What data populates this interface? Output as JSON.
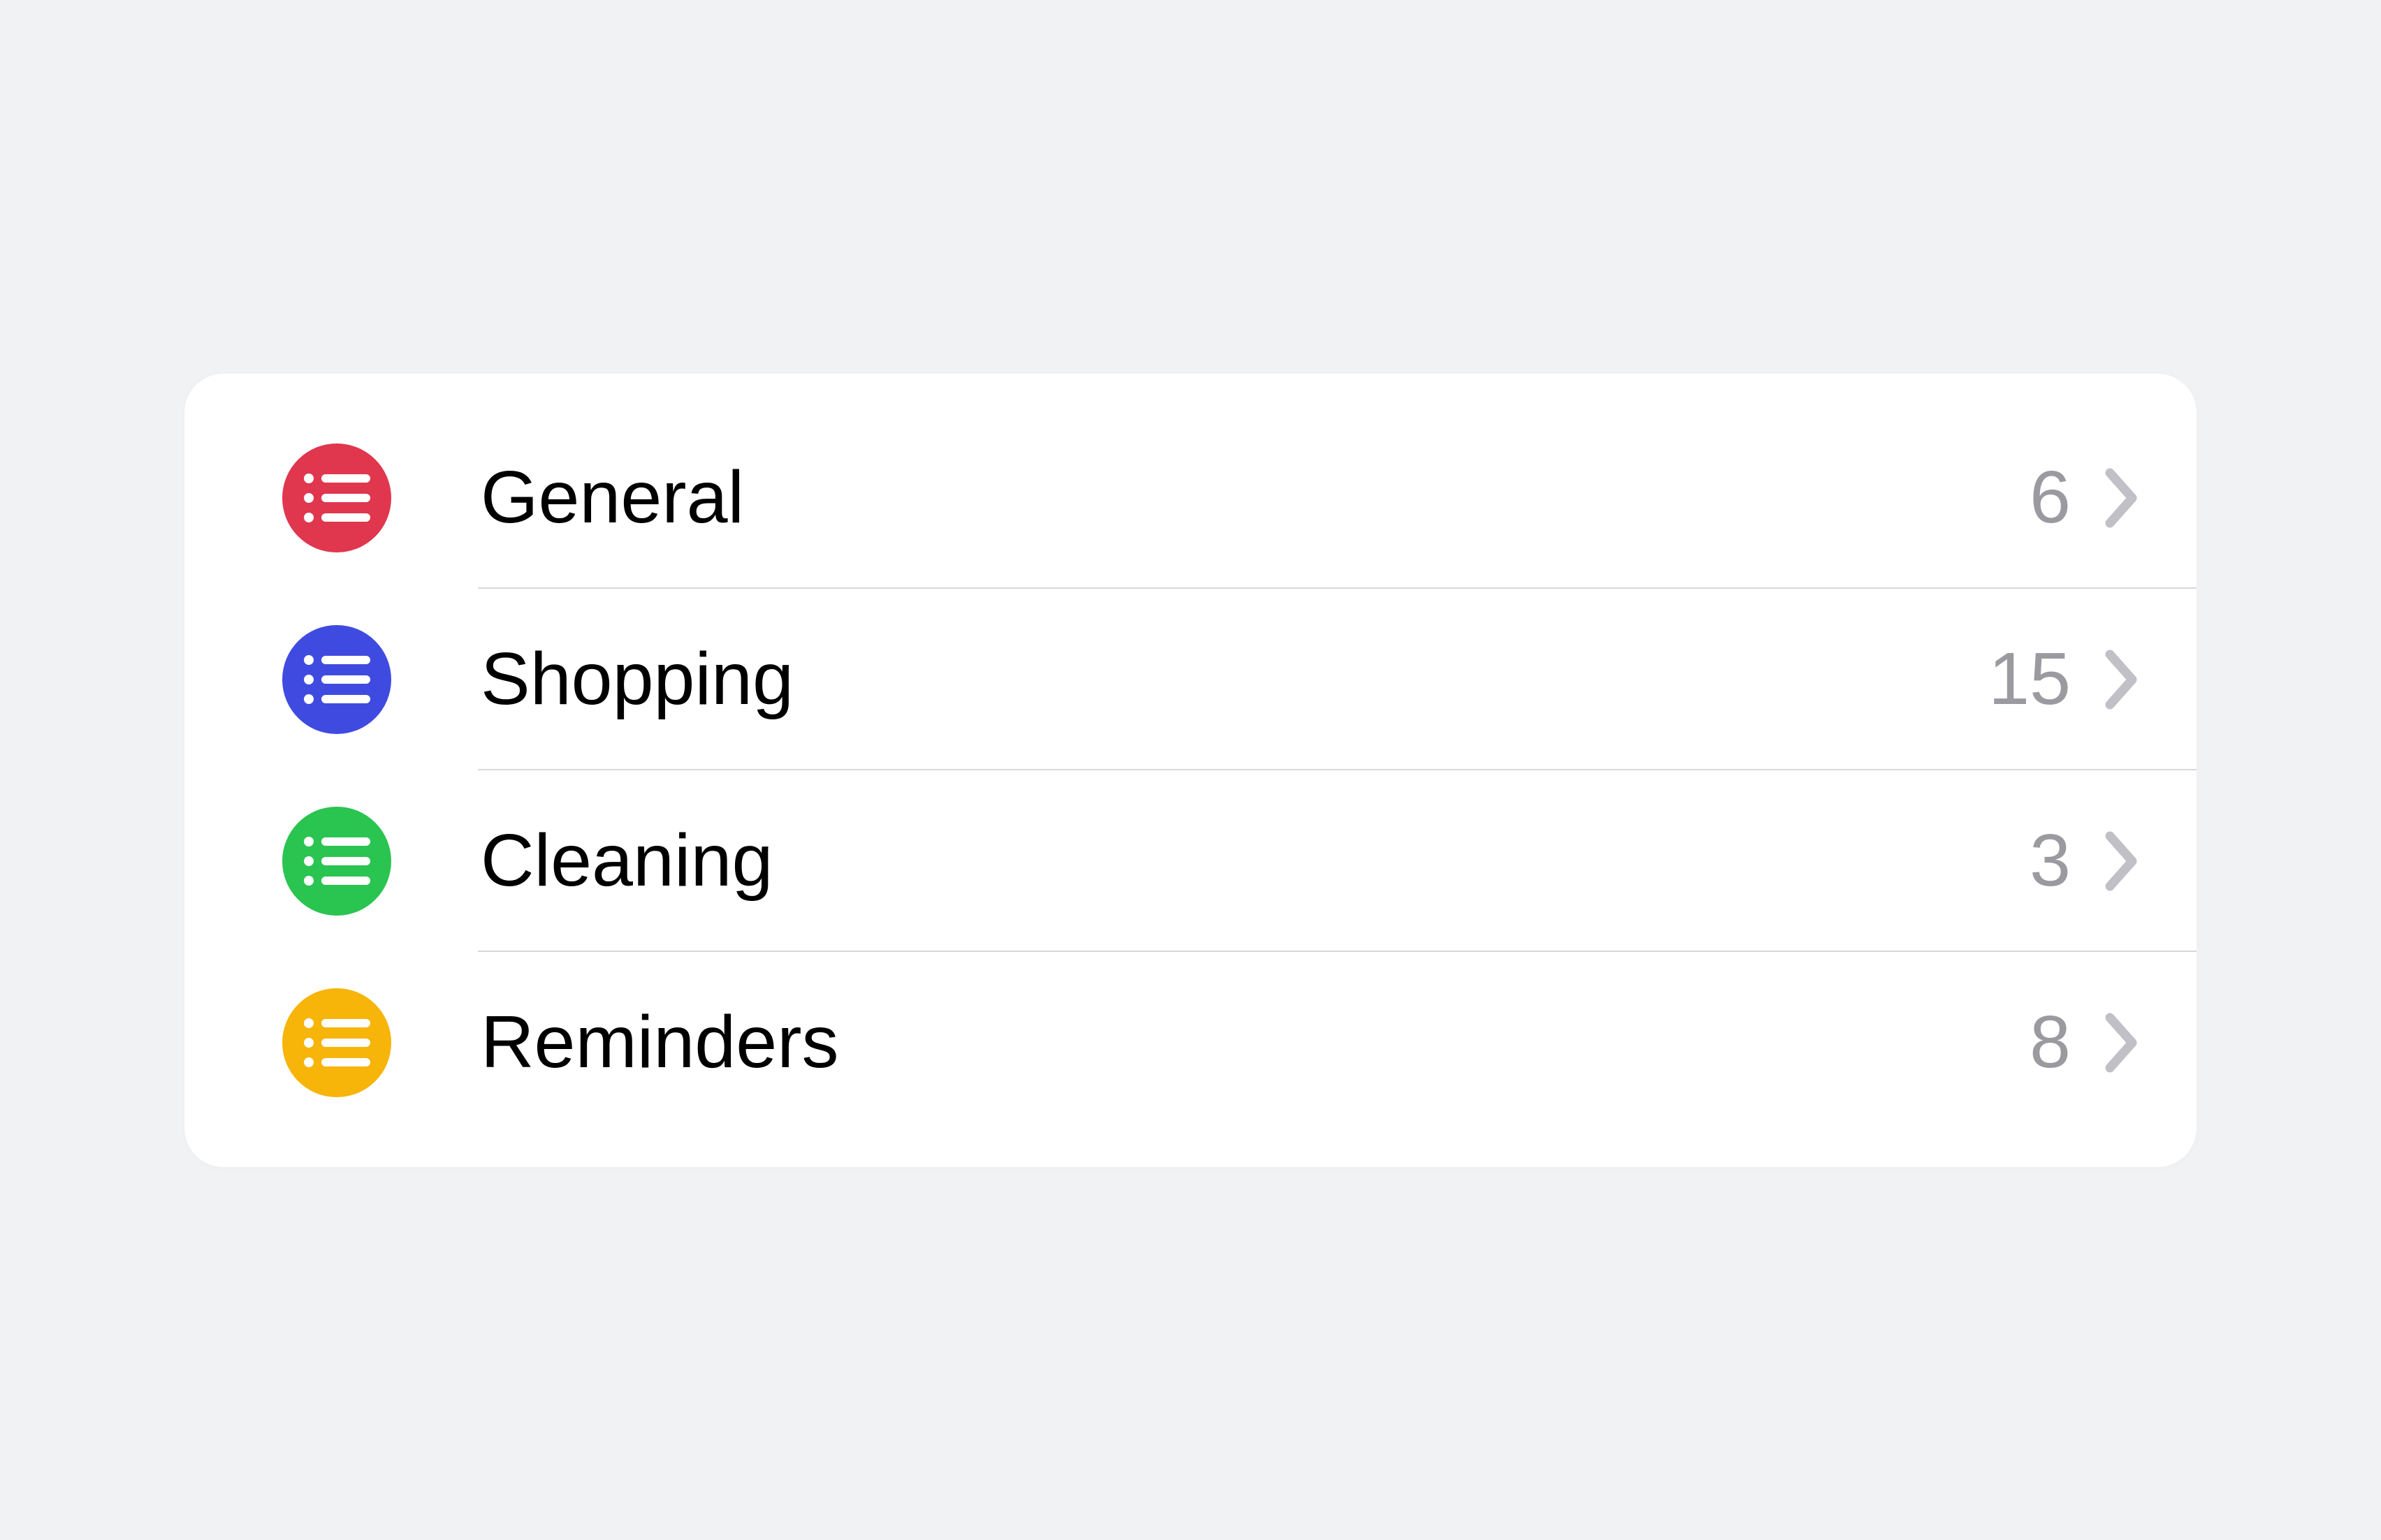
{
  "lists": [
    {
      "label": "General",
      "count": "6",
      "color": "#e0364e",
      "icon": "list-bullet-icon"
    },
    {
      "label": "Shopping",
      "count": "15",
      "color": "#3f4be0",
      "icon": "list-bullet-icon"
    },
    {
      "label": "Cleaning",
      "count": "3",
      "color": "#2ac451",
      "icon": "list-bullet-icon"
    },
    {
      "label": "Reminders",
      "count": "8",
      "color": "#f7b409",
      "icon": "list-bullet-icon"
    }
  ],
  "chevron_color": "#c0c0c6",
  "count_color": "#9a9aa0"
}
